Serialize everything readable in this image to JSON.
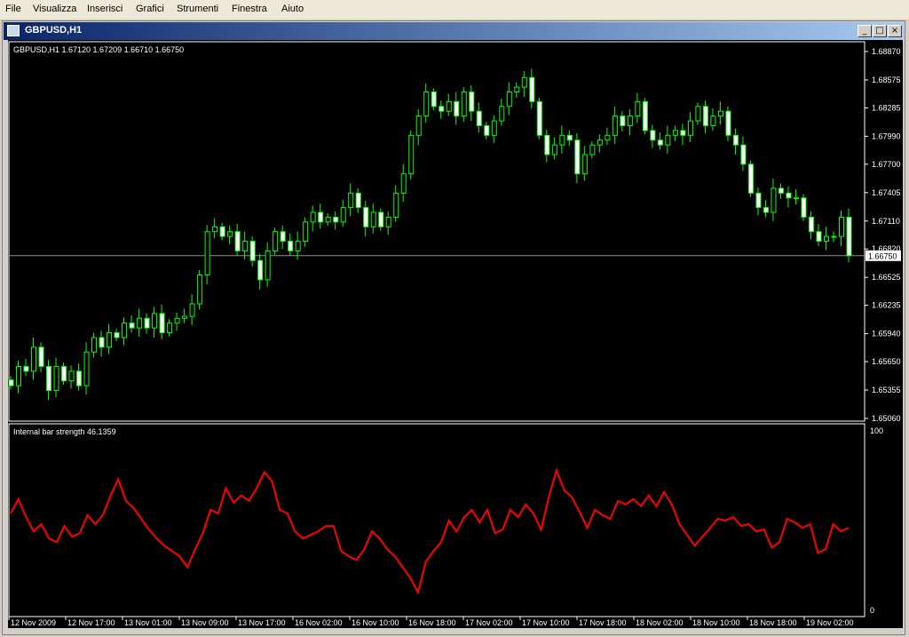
{
  "menu": [
    "File",
    "Visualizza",
    "Inserisci",
    "Grafici",
    "Strumenti",
    "Finestra",
    "Aiuto"
  ],
  "window": {
    "title": "GBPUSD,H1",
    "min_glyph": "_",
    "max_glyph": "□",
    "close_glyph": "×"
  },
  "chart_data": [
    {
      "type": "candlestick",
      "symbol_line": "GBPUSD,H1  1.67120  1.67209  1.66710  1.66750",
      "price_ticks": [
        "1.68870",
        "1.68575",
        "1.68285",
        "1.67990",
        "1.67700",
        "1.67405",
        "1.67110",
        "1.66820",
        "1.66525",
        "1.66235",
        "1.65940",
        "1.65650",
        "1.65355",
        "1.65060"
      ],
      "tick_values": [
        1.6887,
        1.68575,
        1.68285,
        1.6799,
        1.677,
        1.67405,
        1.6711,
        1.6682,
        1.66525,
        1.66235,
        1.6594,
        1.6565,
        1.65355,
        1.6506
      ],
      "current_price": "1.66750",
      "current_value": 1.6675,
      "ylim": [
        1.6506,
        1.6887
      ],
      "up_color": "#00ff00",
      "down_color": "#ffffff",
      "closes": [
        1.654,
        1.656,
        1.6555,
        1.658,
        1.656,
        1.6535,
        1.656,
        1.6545,
        1.6555,
        1.654,
        1.6575,
        1.659,
        1.658,
        1.6595,
        1.659,
        1.6605,
        1.66,
        1.661,
        1.66,
        1.6615,
        1.6595,
        1.6605,
        1.661,
        1.6612,
        1.6625,
        1.6655,
        1.67,
        1.6705,
        1.6695,
        1.67,
        1.668,
        1.669,
        1.667,
        1.665,
        1.668,
        1.67,
        1.669,
        1.668,
        1.669,
        1.671,
        1.672,
        1.671,
        1.6715,
        1.671,
        1.6725,
        1.674,
        1.6725,
        1.6705,
        1.672,
        1.6705,
        1.6715,
        1.674,
        1.676,
        1.68,
        1.682,
        1.6845,
        1.683,
        1.6825,
        1.6835,
        1.682,
        1.6845,
        1.6825,
        1.681,
        1.68,
        1.6815,
        1.683,
        1.6845,
        1.685,
        1.686,
        1.6835,
        1.68,
        1.678,
        1.679,
        1.68,
        1.6795,
        1.676,
        1.678,
        1.679,
        1.6795,
        1.68,
        1.682,
        1.681,
        1.682,
        1.6835,
        1.6805,
        1.6795,
        1.679,
        1.68,
        1.6805,
        1.68,
        1.6815,
        1.683,
        1.681,
        1.682,
        1.6825,
        1.68,
        1.679,
        1.677,
        1.674,
        1.6725,
        1.672,
        1.6745,
        1.674,
        1.6735,
        1.6735,
        1.6715,
        1.67,
        1.669,
        1.6695,
        1.6695,
        1.6715,
        1.6675
      ]
    },
    {
      "type": "line",
      "title": "Internal bar strength 46.1359",
      "ylim": [
        0,
        100
      ],
      "y_ticks": [
        "100",
        "0"
      ],
      "line_color": "#ff0000",
      "x_ticks": [
        "12 Nov 2009",
        "12 Nov 17:00",
        "13 Nov 01:00",
        "13 Nov 09:00",
        "13 Nov 17:00",
        "16 Nov 02:00",
        "16 Nov 10:00",
        "16 Nov 18:00",
        "17 Nov 02:00",
        "17 Nov 10:00",
        "17 Nov 18:00",
        "18 Nov 02:00",
        "18 Nov 10:00",
        "18 Nov 18:00",
        "19 Nov 02:00"
      ],
      "values": [
        54,
        62,
        52,
        44,
        48,
        40,
        38,
        47,
        41,
        43,
        53,
        48,
        53,
        64,
        73,
        61,
        57,
        51,
        45,
        40,
        36,
        33,
        30,
        24,
        34,
        43,
        56,
        54,
        68,
        60,
        64,
        61,
        68,
        77,
        72,
        56,
        54,
        44,
        40,
        42,
        44,
        47,
        47,
        33,
        30,
        28,
        34,
        44,
        40,
        34,
        30,
        24,
        18,
        10,
        27,
        33,
        38,
        50,
        44,
        52,
        56,
        49,
        56,
        43,
        45,
        56,
        52,
        59,
        54,
        45,
        63,
        78,
        67,
        63,
        55,
        46,
        56,
        53,
        51,
        61,
        59,
        62,
        58,
        64,
        58,
        66,
        59,
        48,
        42,
        36,
        41,
        46,
        51,
        50,
        52,
        47,
        48,
        44,
        45,
        35,
        38,
        51,
        49,
        46,
        48,
        32,
        34,
        48,
        44,
        46
      ]
    }
  ]
}
